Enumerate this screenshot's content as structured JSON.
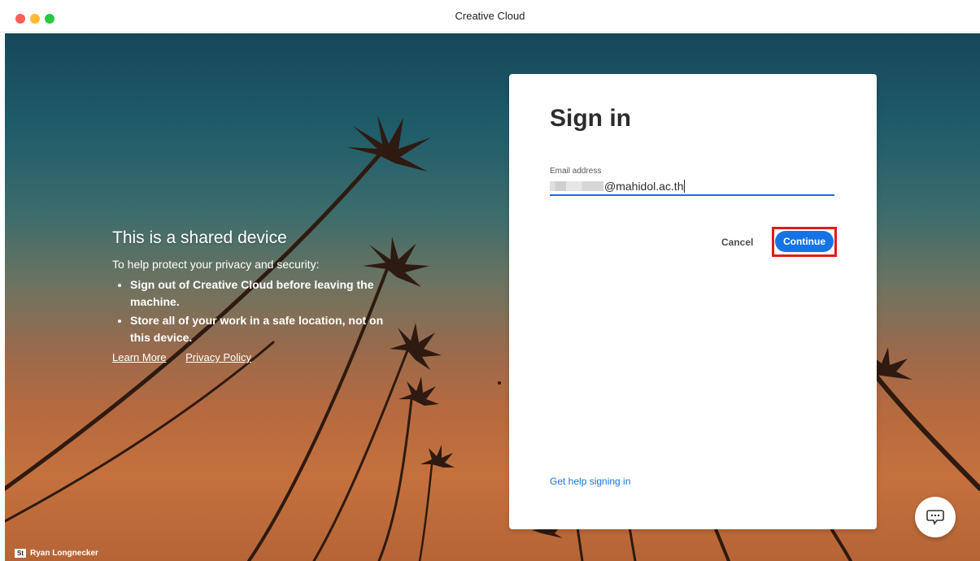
{
  "window": {
    "title": "Creative Cloud"
  },
  "info": {
    "heading": "This is a shared device",
    "intro": "To help protect your privacy and security:",
    "bullets": [
      "Sign out of Creative Cloud before leaving the machine.",
      "Store all of your work in a safe location, not on this device."
    ],
    "learn_more": "Learn More",
    "privacy_policy": "Privacy Policy"
  },
  "signin": {
    "title": "Sign in",
    "email_label": "Email address",
    "email_visible_value": "@mahidol.ac.th",
    "cancel_label": "Cancel",
    "continue_label": "Continue",
    "help_link": "Get help signing in"
  },
  "credit": {
    "badge": "St",
    "name": "Ryan Longnecker"
  },
  "icons": {
    "chat": "chat-bubble-icon",
    "stock_badge": "adobe-stock-icon"
  },
  "colors": {
    "accent": "#1473e6",
    "highlight_box": "#e01a1a",
    "traffic_close": "#ff5f57",
    "traffic_minimize": "#febc2e",
    "traffic_maximize": "#28c840"
  }
}
